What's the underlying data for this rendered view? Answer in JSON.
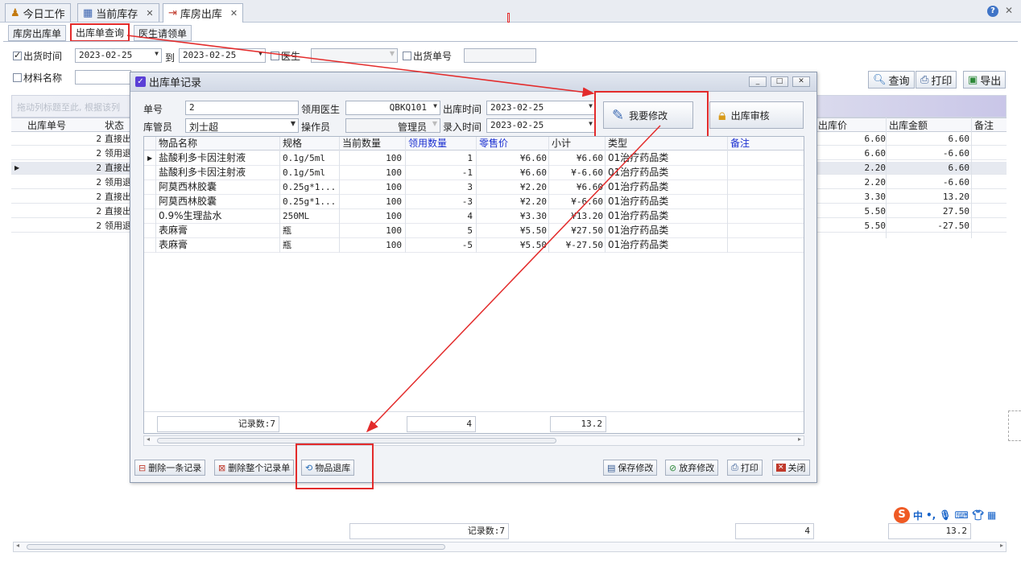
{
  "doc_tabs": [
    {
      "label": "今日工作",
      "icon": "user-icon"
    },
    {
      "label": "当前库存",
      "icon": "table-icon"
    },
    {
      "label": "库房出库",
      "icon": "warehouse-icon"
    }
  ],
  "sub_tabs": [
    "库房出库单",
    "出库单查询",
    "医生请领单"
  ],
  "filter": {
    "ship_time_label": "出货时间",
    "date_from": "2023-02-25",
    "to_label": "到",
    "date_to": "2023-02-25",
    "doctor_label": "医生",
    "doctor_value": "",
    "order_no_label": "出货单号",
    "order_no_value": "",
    "material_label": "材料名称",
    "material_value": "",
    "query_btn": "查询",
    "print_btn": "打印",
    "export_btn": "导出"
  },
  "bg_grid": {
    "group_hint": "拖动列标题至此, 根据该列",
    "headers": {
      "order_no": "出库单号",
      "status": "状态",
      "price": "出库价",
      "amount": "出库金额",
      "remark": "备注"
    },
    "rows": [
      {
        "order_no": "2",
        "status": "直接出",
        "price": "6.60",
        "amount": "6.60"
      },
      {
        "order_no": "2",
        "status": "领用退",
        "price": "6.60",
        "amount": "-6.60"
      },
      {
        "order_no": "2",
        "status": "直接出",
        "price": "2.20",
        "amount": "6.60"
      },
      {
        "order_no": "2",
        "status": "领用退",
        "price": "2.20",
        "amount": "-6.60"
      },
      {
        "order_no": "2",
        "status": "直接出",
        "price": "3.30",
        "amount": "13.20"
      },
      {
        "order_no": "2",
        "status": "直接出",
        "price": "5.50",
        "amount": "27.50"
      },
      {
        "order_no": "2",
        "status": "领用退",
        "price": "5.50",
        "amount": "-27.50"
      }
    ],
    "footer": {
      "count": "记录数:7",
      "qty": "4",
      "total": "13.2"
    }
  },
  "dialog": {
    "title": "出库单记录",
    "order_no_label": "单号",
    "order_no": "2",
    "doctor_label": "领用医生",
    "doctor": "QBKQ101",
    "out_time_label": "出库时间",
    "out_time": "2023-02-25",
    "keeper_label": "库管员",
    "keeper": "刘士超",
    "operator_label": "操作员",
    "operator": "管理员",
    "entry_time_label": "录入时间",
    "entry_time": "2023-02-25",
    "modify_btn": "我要修改",
    "audit_btn": "出库审核",
    "grid": {
      "headers": {
        "name": "物品名称",
        "spec": "规格",
        "stock": "当前数量",
        "qty": "领用数量",
        "price": "零售价",
        "subtotal": "小计",
        "type": "类型",
        "remark": "备注"
      },
      "rows": [
        {
          "name": "盐酸利多卡因注射液",
          "spec": "0.1g/5ml",
          "stock": "100",
          "qty": "1",
          "price": "¥6.60",
          "subtotal": "¥6.60",
          "type": "01治疗药品类"
        },
        {
          "name": "盐酸利多卡因注射液",
          "spec": "0.1g/5ml",
          "stock": "100",
          "qty": "-1",
          "price": "¥6.60",
          "subtotal": "¥-6.60",
          "type": "01治疗药品类"
        },
        {
          "name": "阿莫西林胶囊",
          "spec": "0.25g*1...",
          "stock": "100",
          "qty": "3",
          "price": "¥2.20",
          "subtotal": "¥6.60",
          "type": "01治疗药品类"
        },
        {
          "name": "阿莫西林胶囊",
          "spec": "0.25g*1...",
          "stock": "100",
          "qty": "-3",
          "price": "¥2.20",
          "subtotal": "¥-6.60",
          "type": "01治疗药品类"
        },
        {
          "name": "0.9%生理盐水",
          "spec": "250ML",
          "stock": "100",
          "qty": "4",
          "price": "¥3.30",
          "subtotal": "¥13.20",
          "type": "01治疗药品类"
        },
        {
          "name": "表麻膏",
          "spec": "瓶",
          "stock": "100",
          "qty": "5",
          "price": "¥5.50",
          "subtotal": "¥27.50",
          "type": "01治疗药品类"
        },
        {
          "name": "表麻膏",
          "spec": "瓶",
          "stock": "100",
          "qty": "-5",
          "price": "¥5.50",
          "subtotal": "¥-27.50",
          "type": "01治疗药品类"
        }
      ],
      "footer": {
        "count": "记录数:7",
        "qty": "4",
        "subtotal": "13.2"
      }
    },
    "buttons": {
      "delete_one": "删除一条记录",
      "delete_all": "删除整个记录单",
      "return_goods": "物品退库",
      "save": "保存修改",
      "discard": "放弃修改",
      "print": "打印",
      "close": "关闭"
    }
  },
  "ime": {
    "lang": "中",
    "punct": "•,"
  },
  "colors": {
    "annotation_red": "#e32b2b",
    "accent_blue": "#1b2fd1"
  }
}
